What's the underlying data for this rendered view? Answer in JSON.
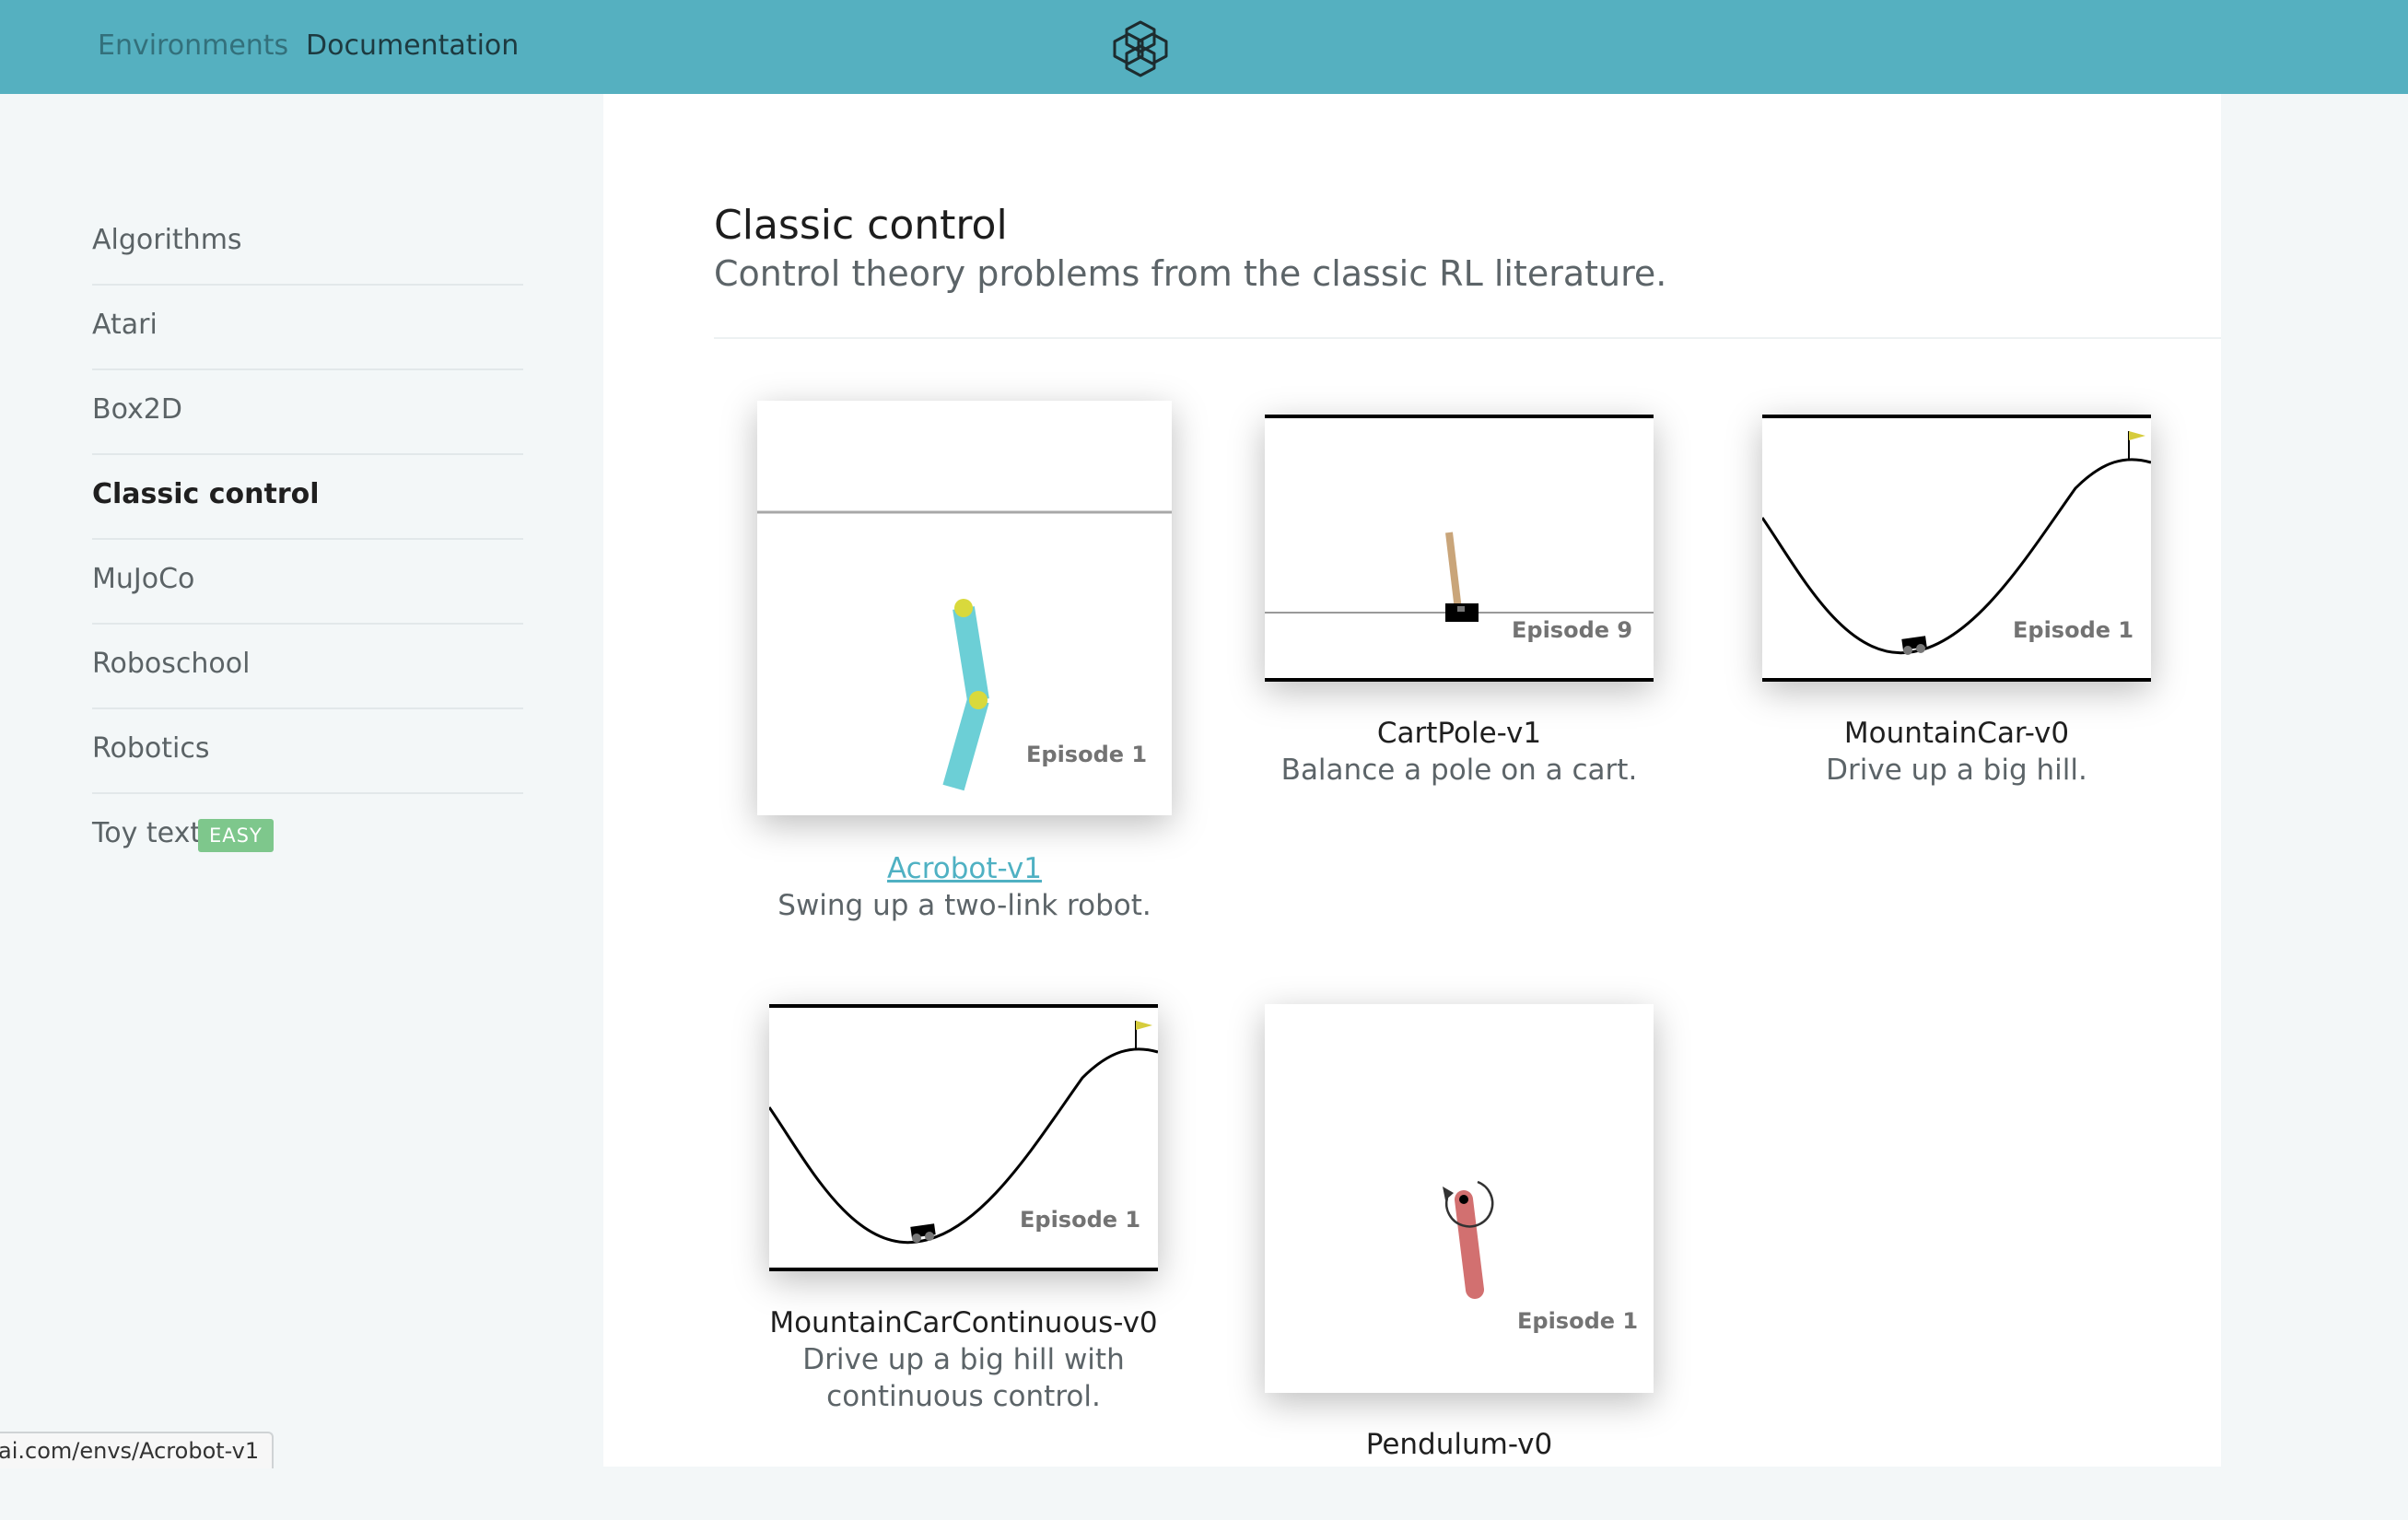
{
  "nav": {
    "environments": "Environments",
    "documentation": "Documentation",
    "logo_icon": "gym-logo-icon"
  },
  "sidebar": {
    "items": [
      {
        "label": "Algorithms"
      },
      {
        "label": "Atari"
      },
      {
        "label": "Box2D"
      },
      {
        "label": "Classic control",
        "active": true
      },
      {
        "label": "MuJoCo"
      },
      {
        "label": "Roboschool"
      },
      {
        "label": "Robotics"
      },
      {
        "label": "Toy text",
        "badge": "EASY"
      }
    ]
  },
  "section": {
    "title": "Classic control",
    "subtitle": "Control theory problems from the classic RL literature."
  },
  "envs": [
    {
      "name": "Acrobot-v1",
      "desc": "Swing up a two-link robot.",
      "episode": "Episode 1",
      "hovered": true
    },
    {
      "name": "CartPole-v1",
      "desc": "Balance a pole on a cart.",
      "episode": "Episode 9"
    },
    {
      "name": "MountainCar-v0",
      "desc": "Drive up a big hill.",
      "episode": "Episode 1"
    },
    {
      "name": "MountainCarContinuous-v0",
      "desc_line1": "Drive up a big hill with",
      "desc_line2": "continuous control.",
      "episode": "Episode 1"
    },
    {
      "name": "Pendulum-v0",
      "episode": "Episode 1"
    }
  ],
  "status_bar": {
    "url": "ai.com/envs/Acrobot-v1"
  },
  "colors": {
    "header": "#55b0c0",
    "accent_link": "#4fb1c3",
    "badge": "#7ec78c",
    "acrobot_link": "#6ccfd6",
    "pendulum_rod": "#d27070"
  }
}
